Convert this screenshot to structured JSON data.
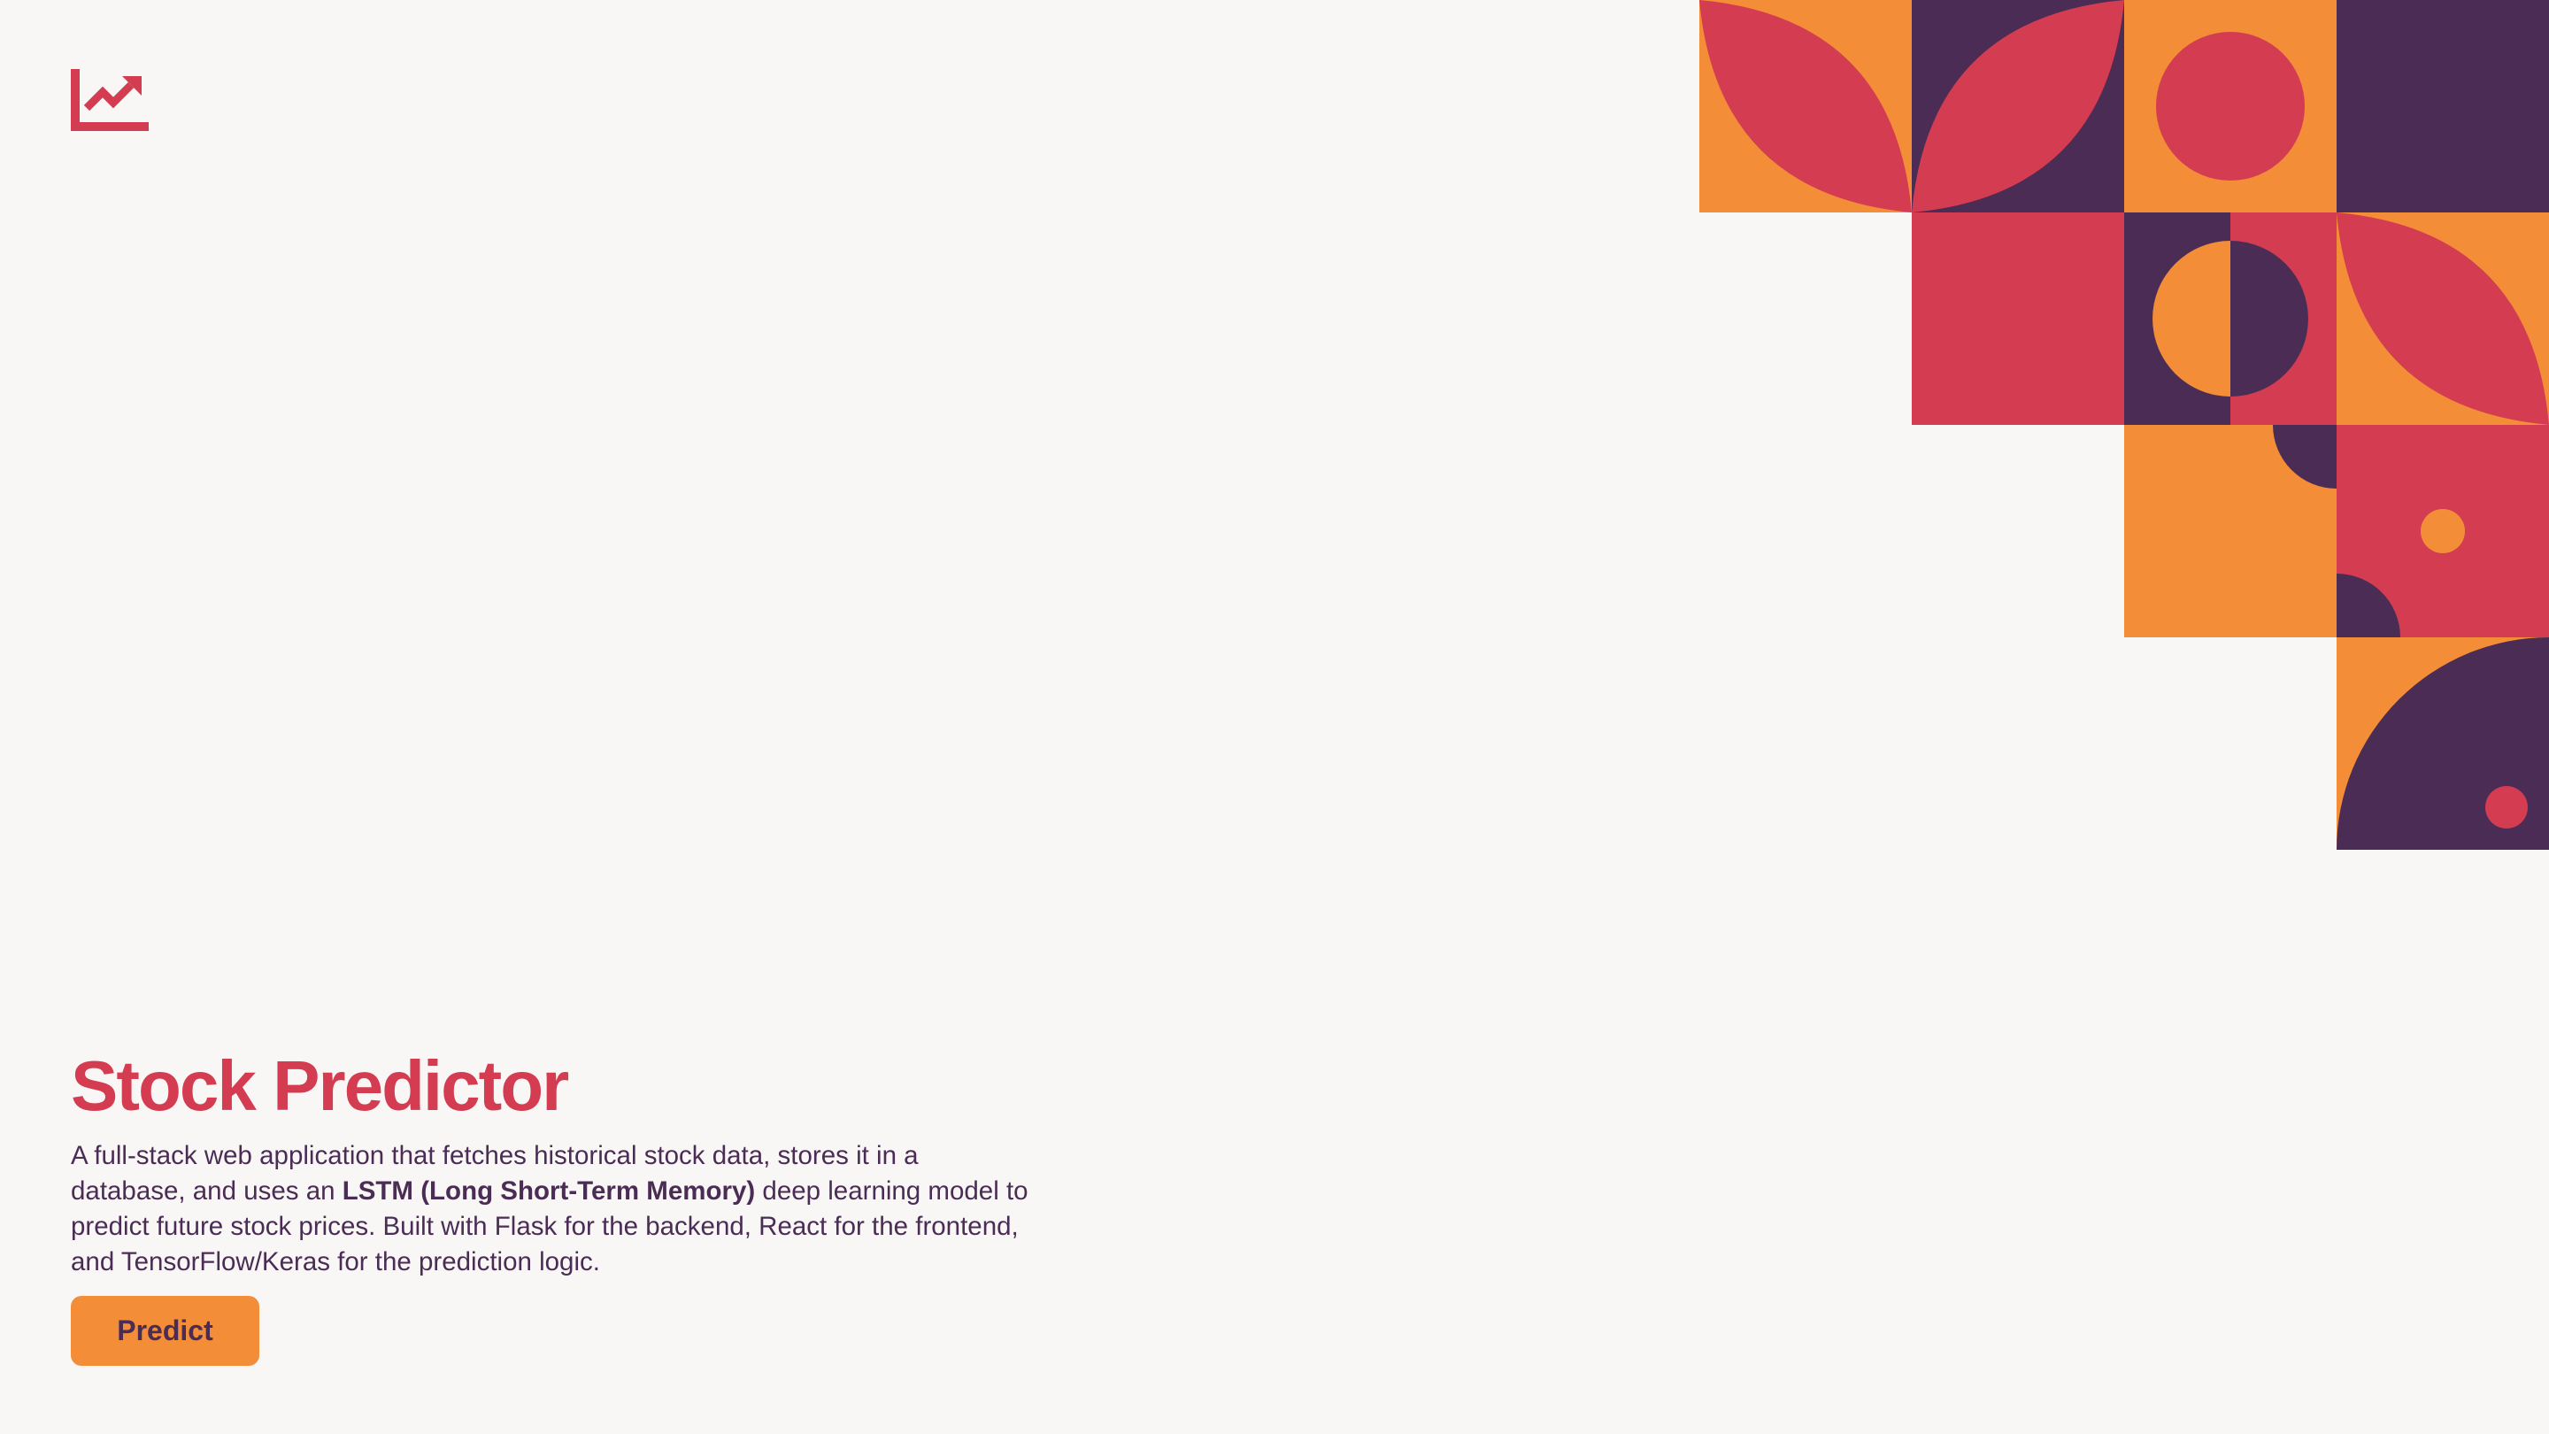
{
  "logo": {
    "icon": "trending-up-chart-icon"
  },
  "hero": {
    "title": "Stock Predictor",
    "description_before": "A full-stack web application that fetches historical stock data, stores it in a database, and uses an ",
    "description_bold": "LSTM (Long Short-Term Memory)",
    "description_after": " deep learning model to predict future stock prices. Built with Flask for the backend, React for the frontend, and TensorFlow/Keras for the prediction logic.",
    "button_label": "Predict"
  },
  "colors": {
    "background": "#f9f7f6",
    "red": "#d43d51",
    "orange": "#f38d38",
    "purple": "#4a2c55"
  }
}
